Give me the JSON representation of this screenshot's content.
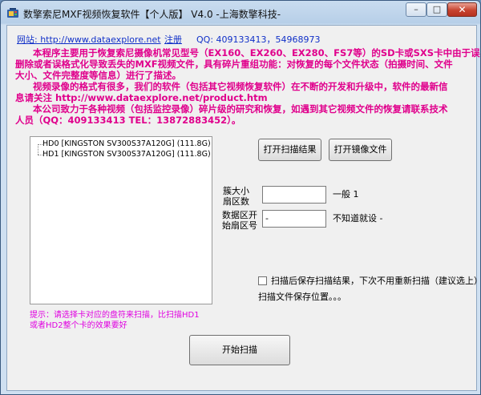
{
  "window": {
    "title": "数擎索尼MXF视频恢复软件【个人版】 V4.0  -上海数擎科技-",
    "min_symbol": "–",
    "max_symbol": "□",
    "close_symbol": "✕"
  },
  "links": {
    "website": "网站: http://www.dataexplore.net",
    "register": "注册",
    "qq": "QQ: 409133413，54968973"
  },
  "description": {
    "line1": "本程序主要用于恢复索尼摄像机常见型号（EX160、EX260、EX280、FS7等）的SD卡或SXS卡中由于误",
    "line2": "删除或者误格式化导致丢失的MXF视频文件，具有碎片重组功能：对恢复的每个文件状态（拍摄时间、文件",
    "line3": "大小、文件完整度等信息）进行了描述。",
    "line4": "视频录像的格式有很多，我们的软件（包括其它视频恢复软件）在不断的开发和升级中，软件的最新信",
    "line5": "息请关注 http://www.dataexplore.net/product.htm",
    "line6": "本公司致力于各种视频（包括监控录像）碎片级的研究和恢复，如遇到其它视频文件的恢复请联系技术",
    "line7": "人员（QQ：409133413  TEL：13872883452）。"
  },
  "disks": [
    {
      "id": "HD0",
      "model": "[KINGSTON SV300S37A120G]",
      "size": "(111.8G)"
    },
    {
      "id": "HD1",
      "model": "[KINGSTON SV300S37A120G]",
      "size": "(111.8G)"
    }
  ],
  "buttons": {
    "open_scan_result": "打开扫描结果",
    "open_image_file": "打开镜像文件",
    "start_scan": "开始扫描"
  },
  "fields": {
    "cluster_label": "簇大小\n扇区数",
    "cluster_value": "",
    "cluster_note": "一般 1",
    "data_start_label": "数据区开\n始扇区号",
    "data_start_value": "-",
    "data_start_note": "不知道就设 -"
  },
  "options": {
    "save_scan_label": "扫描后保存扫描结果，下次不用重新扫描（建议选上）",
    "save_scan_checked": false,
    "save_location_label": "扫描文件保存位置。。。"
  },
  "hint": {
    "line1": "提示：请选择卡对应的盘符来扫描，比扫描HD1",
    "line2": "或者HD2整个卡的效果要好"
  }
}
